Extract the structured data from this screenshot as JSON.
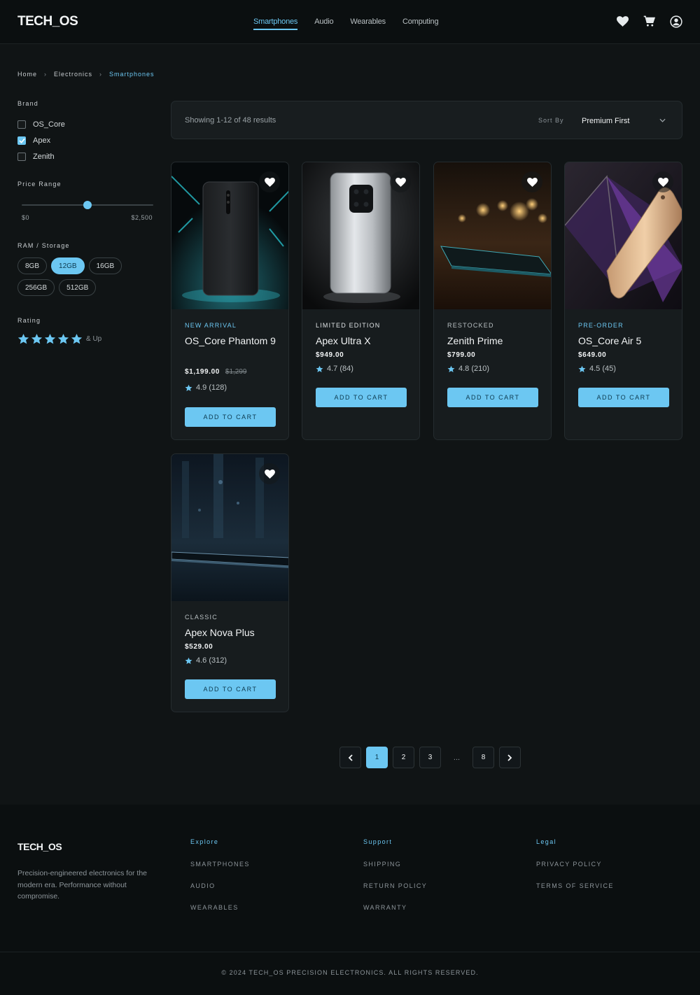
{
  "header": {
    "logo": "TECH_OS",
    "nav": [
      {
        "label": "Smartphones",
        "active": true
      },
      {
        "label": "Audio",
        "active": false
      },
      {
        "label": "Wearables",
        "active": false
      },
      {
        "label": "Computing",
        "active": false
      }
    ],
    "icons": [
      "heart-icon",
      "cart-icon",
      "account-icon"
    ]
  },
  "breadcrumb": [
    "Home",
    "Electronics",
    "Smartphones"
  ],
  "filters": {
    "brand": {
      "title": "Brand",
      "options": [
        {
          "label": "OS_Core",
          "checked": false
        },
        {
          "label": "Apex",
          "checked": true
        },
        {
          "label": "Zenith",
          "checked": false
        }
      ]
    },
    "price": {
      "title": "Price Range",
      "min_label": "$0",
      "max_label": "$2,500",
      "value_fraction": 0.5
    },
    "ram": {
      "title": "RAM / Storage",
      "options": [
        {
          "label": "8GB",
          "selected": false
        },
        {
          "label": "12GB",
          "selected": true
        },
        {
          "label": "16GB",
          "selected": false
        },
        {
          "label": "256GB",
          "selected": false
        },
        {
          "label": "512GB",
          "selected": false
        }
      ]
    },
    "rating": {
      "title": "Rating",
      "stars": 5,
      "suffix": "& Up"
    }
  },
  "sortbar": {
    "results": "Showing 1-12 of 48 results",
    "sort_label": "Sort By",
    "sort_value": "Premium First"
  },
  "products": [
    {
      "tag": "NEW ARRIVAL",
      "tag_color": "#6cc7f2",
      "name": "OS_Core Phantom 9",
      "price": "$1,199.00",
      "old_price": "$1,299",
      "rating": "4.9 (128)",
      "cta": "ADD TO CART",
      "image": "phone-black"
    },
    {
      "tag": "LIMITED EDITION",
      "tag_color": "#dfe3e5",
      "name": "Apex Ultra X",
      "price": "$949.00",
      "old_price": "",
      "rating": "4.7 (84)",
      "cta": "ADD TO CART",
      "image": "phone-silver"
    },
    {
      "tag": "RESTOCKED",
      "tag_color": "#b9c0c3",
      "name": "Zenith Prime",
      "price": "$799.00",
      "old_price": "",
      "rating": "4.8 (210)",
      "cta": "ADD TO CART",
      "image": "phone-bokeh"
    },
    {
      "tag": "PRE-ORDER",
      "tag_color": "#6cc7f2",
      "name": "OS_Core Air 5",
      "price": "$649.00",
      "old_price": "",
      "rating": "4.5 (45)",
      "cta": "ADD TO CART",
      "image": "phone-gold"
    },
    {
      "tag": "CLASSIC",
      "tag_color": "#b9c0c3",
      "name": "Apex Nova Plus",
      "price": "$529.00",
      "old_price": "",
      "rating": "4.6 (312)",
      "cta": "ADD TO CART",
      "image": "phone-blue"
    }
  ],
  "pagination": {
    "pages": [
      "1",
      "2",
      "3",
      "...",
      "8"
    ],
    "current": "1"
  },
  "footer": {
    "logo": "TECH_OS",
    "description": "Precision-engineered electronics for the modern era. Performance without compromise.",
    "columns": [
      {
        "title": "Explore",
        "links": [
          "SMARTPHONES",
          "AUDIO",
          "WEARABLES"
        ]
      },
      {
        "title": "Support",
        "links": [
          "SHIPPING",
          "RETURN POLICY",
          "WARRANTY"
        ]
      },
      {
        "title": "Legal",
        "links": [
          "PRIVACY POLICY",
          "TERMS OF SERVICE"
        ]
      }
    ],
    "copyright": "© 2024 TECH_OS PRECISION ELECTRONICS. ALL RIGHTS RESERVED."
  },
  "colors": {
    "accent": "#6cc7f2",
    "background": "#101415",
    "surface": "#171c1e"
  }
}
